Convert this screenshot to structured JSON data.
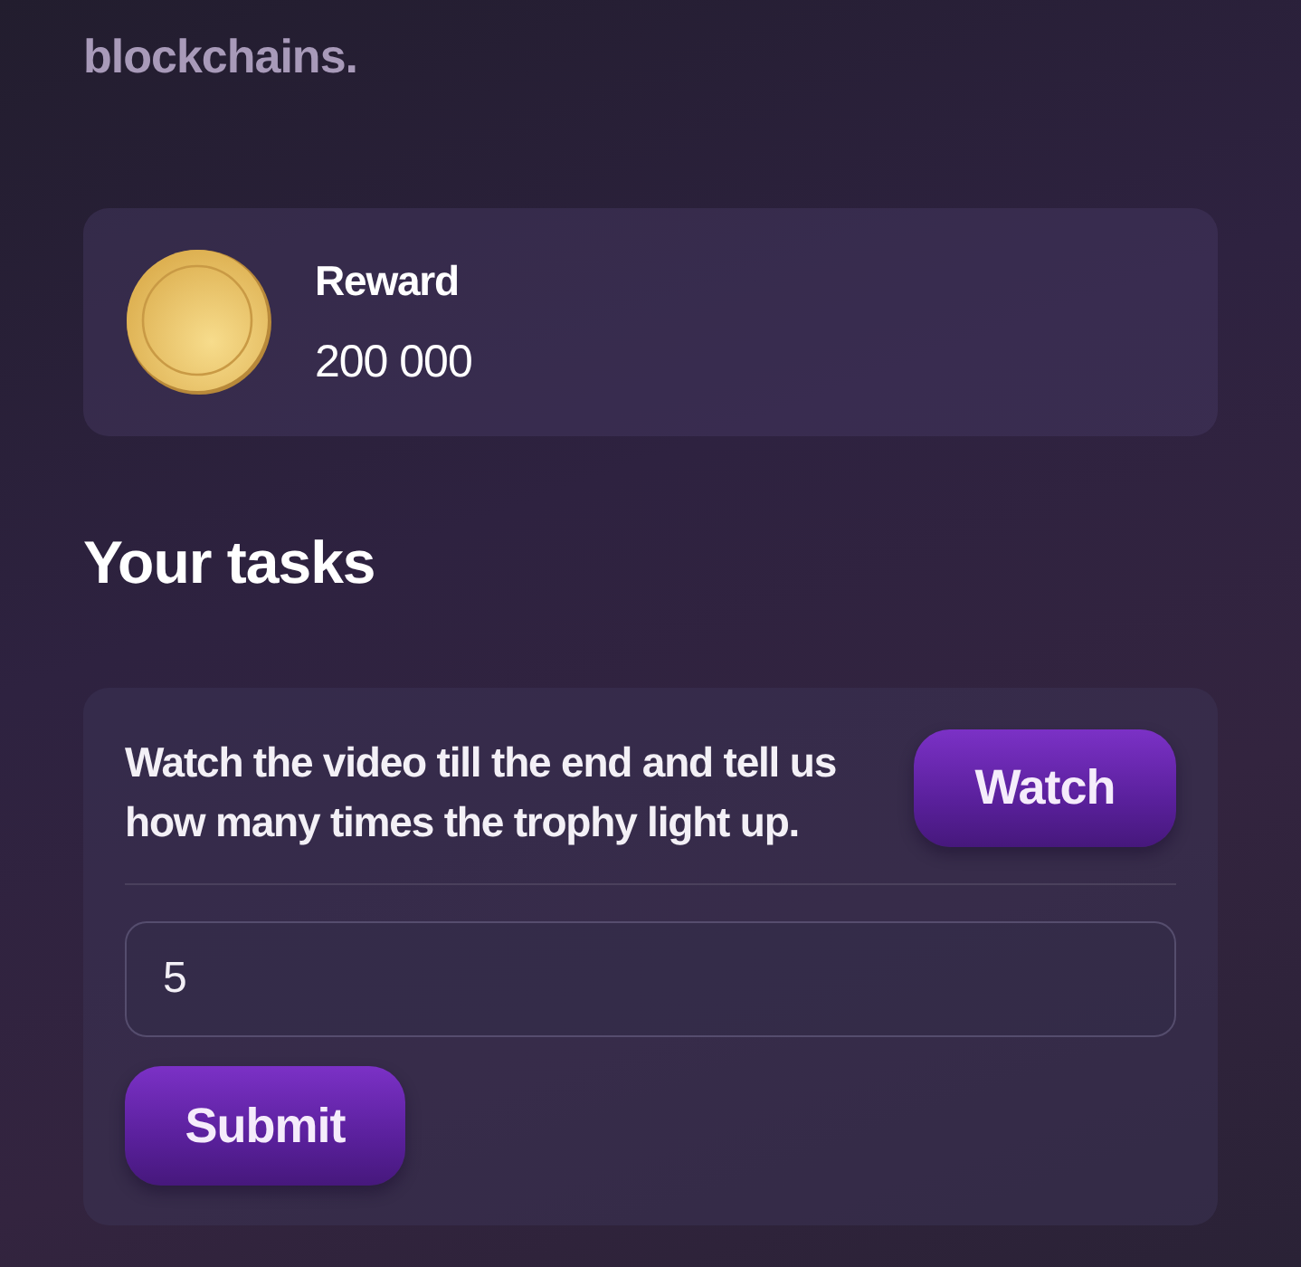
{
  "description": "blockchains.",
  "reward": {
    "label": "Reward",
    "amount": "200 000"
  },
  "tasks_heading": "Your tasks",
  "task": {
    "text": "Watch the video till the end and tell us how many times the trophy light up.",
    "watch_button": "Watch",
    "answer": {
      "value": "5"
    },
    "submit_button": "Submit"
  }
}
